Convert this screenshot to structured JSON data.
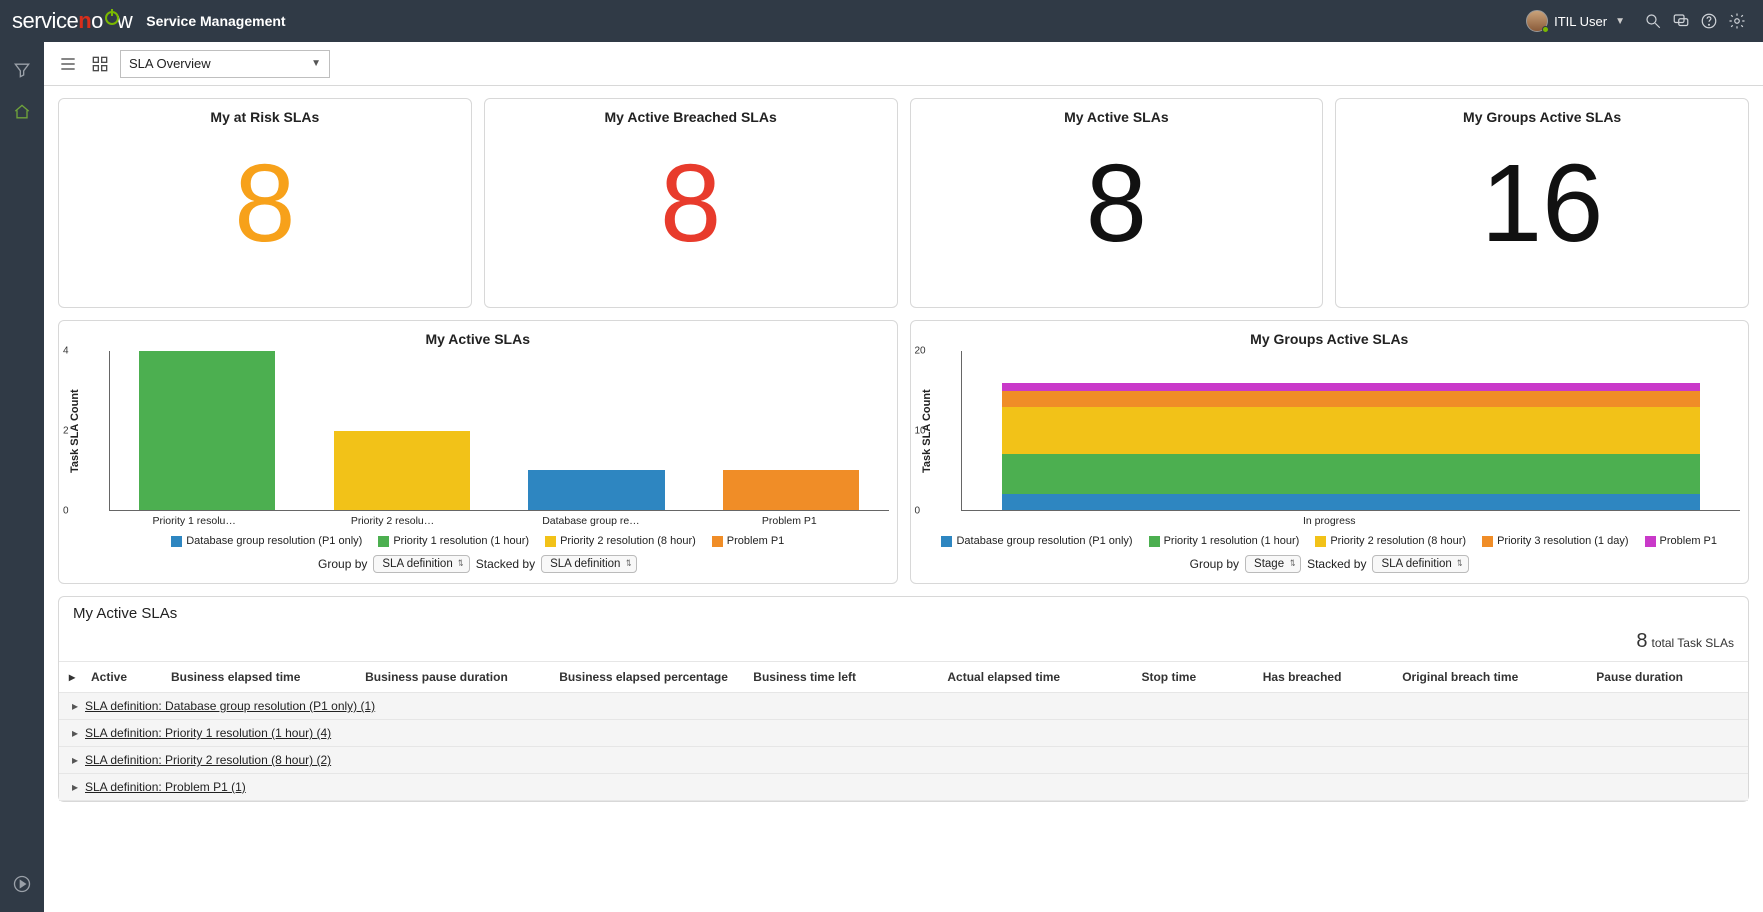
{
  "brand": {
    "app": "Service Management"
  },
  "user": {
    "name": "ITIL User"
  },
  "subbar": {
    "dropdown_value": "SLA Overview"
  },
  "cards": [
    {
      "title": "My at Risk SLAs",
      "value": "8",
      "cls": "c-orange"
    },
    {
      "title": "My Active Breached SLAs",
      "value": "8",
      "cls": "c-red"
    },
    {
      "title": "My Active SLAs",
      "value": "8",
      "cls": "c-black"
    },
    {
      "title": "My Groups Active SLAs",
      "value": "16",
      "cls": "c-black"
    }
  ],
  "chart_data": [
    {
      "id": "my_active",
      "type": "bar",
      "title": "My Active SLAs",
      "ylabel": "Task SLA Count",
      "ylim": [
        0,
        4
      ],
      "yticks": [
        0,
        2,
        4
      ],
      "categories": [
        "Priority 1 resolu…",
        "Priority 2 resolu…",
        "Database group re…",
        "Problem P1"
      ],
      "values": [
        4,
        2,
        1,
        1
      ],
      "bar_colors": [
        "#4caf50",
        "#f2c218",
        "#2e86c1",
        "#f08d27"
      ],
      "legend": [
        {
          "label": "Database group resolution (P1 only)",
          "c": "col-blue"
        },
        {
          "label": "Priority 1 resolution (1 hour)",
          "c": "col-green"
        },
        {
          "label": "Priority 2 resolution (8 hour)",
          "c": "col-yellow"
        },
        {
          "label": "Problem P1",
          "c": "col-orange"
        }
      ],
      "groupby_label": "Group by",
      "groupby_value": "SLA definition",
      "stackedby_label": "Stacked by",
      "stackedby_value": "SLA definition"
    },
    {
      "id": "groups_active",
      "type": "bar-stacked",
      "title": "My Groups Active SLAs",
      "ylabel": "Task SLA Count",
      "ylim": [
        0,
        20
      ],
      "yticks": [
        0,
        10,
        20
      ],
      "categories": [
        "In progress"
      ],
      "series": [
        {
          "name": "Database group resolution (P1 only)",
          "values": [
            2
          ],
          "c": "col-blue",
          "color": "#2e86c1"
        },
        {
          "name": "Priority 1 resolution (1 hour)",
          "values": [
            5
          ],
          "c": "col-green",
          "color": "#4caf50"
        },
        {
          "name": "Priority 2 resolution (8 hour)",
          "values": [
            6
          ],
          "c": "col-yellow",
          "color": "#f2c218"
        },
        {
          "name": "Priority 3 resolution (1 day)",
          "values": [
            2
          ],
          "c": "col-orange",
          "color": "#f08d27"
        },
        {
          "name": "Problem P1",
          "values": [
            1
          ],
          "c": "col-magenta",
          "color": "#c939c9"
        }
      ],
      "total": 16,
      "groupby_label": "Group by",
      "groupby_value": "Stage",
      "stackedby_label": "Stacked by",
      "stackedby_value": "SLA definition"
    }
  ],
  "list": {
    "title": "My Active SLAs",
    "summary_count": "8",
    "summary_label": "total Task SLAs",
    "columns": [
      "Active",
      "Business elapsed time",
      "Business pause duration",
      "Business elapsed percentage",
      "Business time left",
      "Actual elapsed time",
      "Stop time",
      "Has breached",
      "Original breach time",
      "Pause duration"
    ],
    "groups": [
      "SLA definition: Database group resolution (P1 only) (1)",
      "SLA definition: Priority 1 resolution (1 hour) (4)",
      "SLA definition: Priority 2 resolution (8 hour) (2)",
      "SLA definition: Problem P1 (1)"
    ]
  }
}
